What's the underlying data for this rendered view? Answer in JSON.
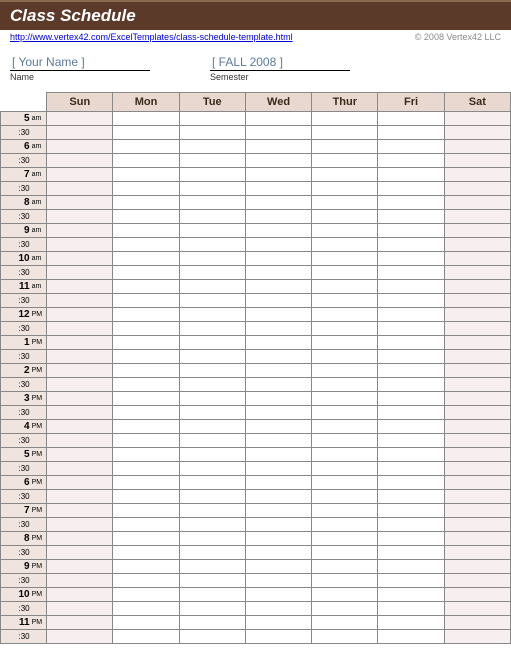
{
  "title": "Class Schedule",
  "link": "http://www.vertex42.com/ExcelTemplates/class-schedule-template.html",
  "copyright": "© 2008 Vertex42 LLC",
  "name_field": {
    "value": "[  Your Name ]",
    "label": "Name"
  },
  "semester_field": {
    "value": "[  FALL 2008  ]",
    "label": "Semester"
  },
  "days": [
    "Sun",
    "Mon",
    "Tue",
    "Wed",
    "Thur",
    "Fri",
    "Sat"
  ],
  "hours": [
    {
      "h": "5",
      "ap": "am"
    },
    {
      "h": "6",
      "ap": "am"
    },
    {
      "h": "7",
      "ap": "am"
    },
    {
      "h": "8",
      "ap": "am"
    },
    {
      "h": "9",
      "ap": "am"
    },
    {
      "h": "10",
      "ap": "am"
    },
    {
      "h": "11",
      "ap": "am"
    },
    {
      "h": "12",
      "ap": "PM"
    },
    {
      "h": "1",
      "ap": "PM"
    },
    {
      "h": "2",
      "ap": "PM"
    },
    {
      "h": "3",
      "ap": "PM"
    },
    {
      "h": "4",
      "ap": "PM"
    },
    {
      "h": "5",
      "ap": "PM"
    },
    {
      "h": "6",
      "ap": "PM"
    },
    {
      "h": "7",
      "ap": "PM"
    },
    {
      "h": "8",
      "ap": "PM"
    },
    {
      "h": "9",
      "ap": "PM"
    },
    {
      "h": "10",
      "ap": "PM"
    },
    {
      "h": "11",
      "ap": "PM"
    }
  ],
  "half": ":30"
}
